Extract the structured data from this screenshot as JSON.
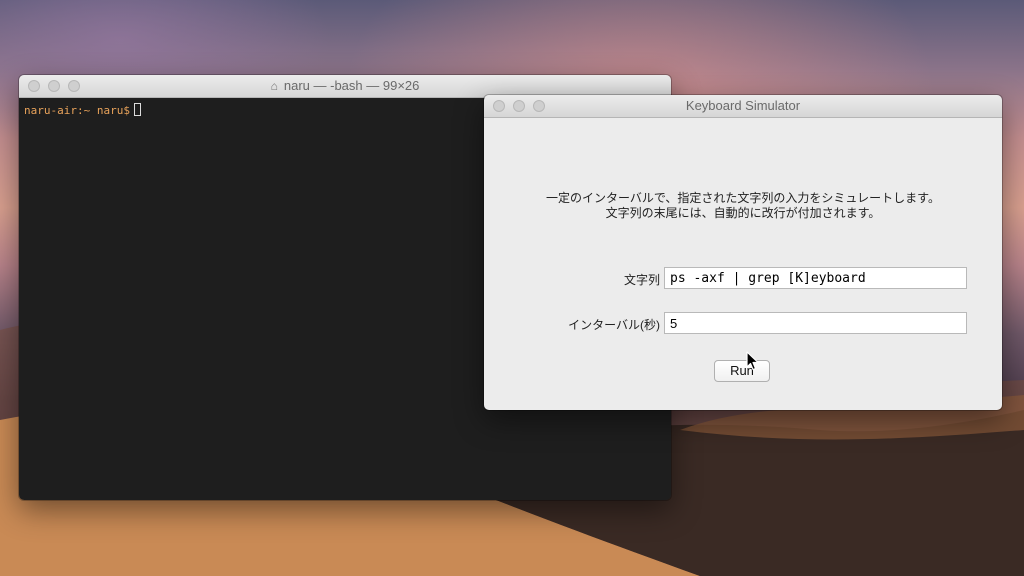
{
  "terminal": {
    "title": "naru — -bash — 99×26",
    "prompt": "naru-air:~ naru$"
  },
  "keyboard_simulator": {
    "title": "Keyboard Simulator",
    "description_line1": "一定のインターバルで、指定された文字列の入力をシミュレートします。",
    "description_line2": "文字列の末尾には、自動的に改行が付加されます。",
    "string_label": "文字列",
    "string_value": "ps -axf | grep [K]eyboard",
    "interval_label": "インターバル(秒)",
    "interval_value": "5",
    "run_label": "Run"
  }
}
